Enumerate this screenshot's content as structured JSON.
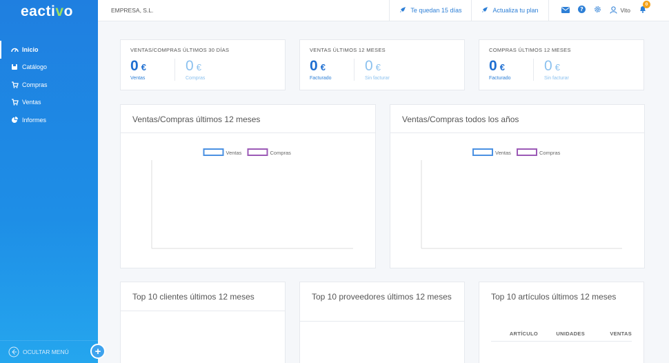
{
  "app": {
    "logo_main": "eacti",
    "logo_accent": "v",
    "logo_end": "o",
    "company": "EMPRESA, S.L.",
    "trial_label": "Te quedan 15 días",
    "upgrade_label": "Actualiza tu plan",
    "user_name": "Vito",
    "notifications": "0"
  },
  "sidebar": {
    "items": [
      {
        "label": "Inicio",
        "icon": "dashboard-icon"
      },
      {
        "label": "Catálogo",
        "icon": "book-icon"
      },
      {
        "label": "Compras",
        "icon": "cart-icon"
      },
      {
        "label": "Ventas",
        "icon": "cart-icon"
      },
      {
        "label": "Informes",
        "icon": "pie-chart-icon"
      }
    ],
    "hide_menu": "OCULTAR MENÚ"
  },
  "stats": [
    {
      "title": "VENTAS/COMPRAS ÚLTIMOS 30 DÍAS",
      "items": [
        {
          "value": "0",
          "currency": "€",
          "label": "Ventas"
        },
        {
          "value": "0",
          "currency": "€",
          "label": "Compras"
        }
      ]
    },
    {
      "title": "VENTAS ÚLTIMOS 12 MESES",
      "items": [
        {
          "value": "0",
          "currency": "€",
          "label": "Facturado"
        },
        {
          "value": "0",
          "currency": "€",
          "label": "Sin facturar"
        }
      ]
    },
    {
      "title": "COMPRAS ÚLTIMOS 12 MESES",
      "items": [
        {
          "value": "0",
          "currency": "€",
          "label": "Facturado"
        },
        {
          "value": "0",
          "currency": "€",
          "label": "Sin facturar"
        }
      ]
    }
  ],
  "charts": [
    {
      "title": "Ventas/Compras últimos 12 meses"
    },
    {
      "title": "Ventas/Compras todos los años"
    }
  ],
  "chart_data": [
    {
      "type": "line",
      "title": "Ventas/Compras últimos 12 meses",
      "legend": "top",
      "series": [
        {
          "name": "Ventas",
          "color": "#4a90e2",
          "values": []
        },
        {
          "name": "Compras",
          "color": "#9b59b6",
          "values": []
        }
      ]
    },
    {
      "type": "line",
      "title": "Ventas/Compras todos los años",
      "legend": "top",
      "series": [
        {
          "name": "Ventas",
          "color": "#4a90e2",
          "values": []
        },
        {
          "name": "Compras",
          "color": "#9b59b6",
          "values": []
        }
      ]
    }
  ],
  "tops": [
    {
      "title": "Top 10 clientes últimos 12 meses"
    },
    {
      "title": "Top 10 proveedores últimos 12 meses"
    },
    {
      "title": "Top 10 artículos últimos 12 meses",
      "columns": [
        "ARTÍCULO",
        "UNIDADES",
        "VENTAS"
      ]
    }
  ],
  "colors": {
    "primary": "#1f7fe0",
    "accent": "#9be15d",
    "ventas": "#4a90e2",
    "compras": "#9b59b6",
    "badge": "#f4a31b"
  }
}
